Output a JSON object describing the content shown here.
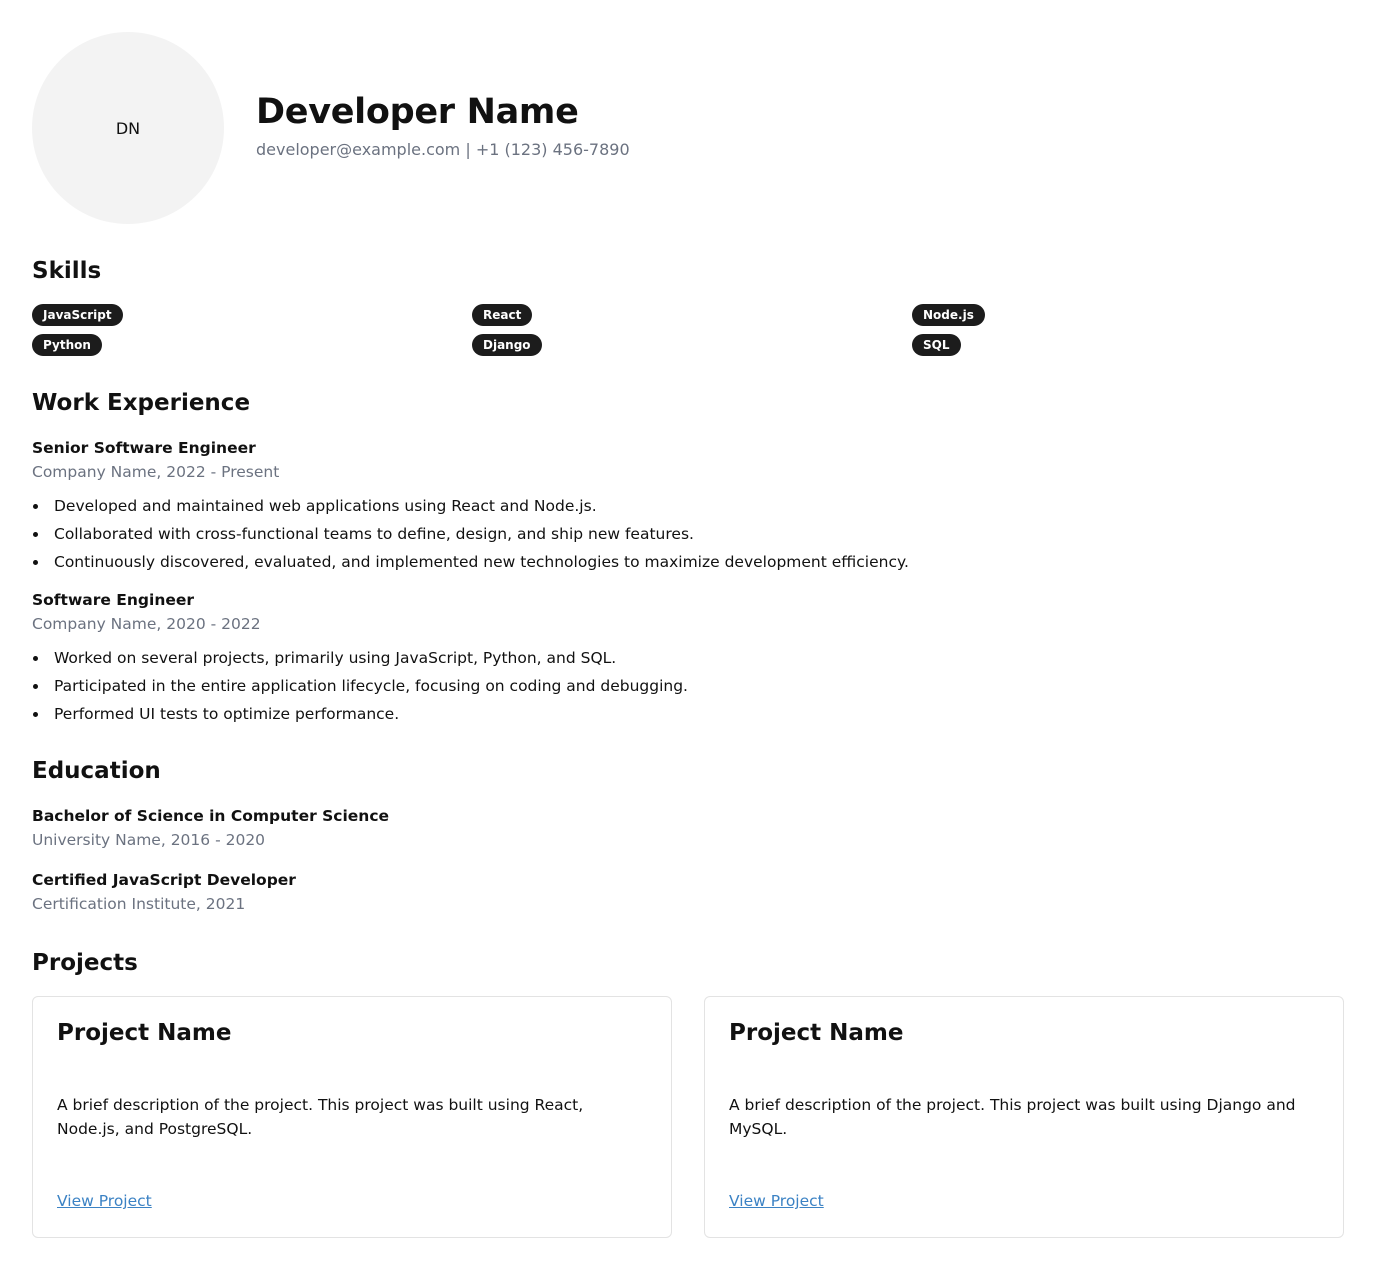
{
  "profile": {
    "initials": "DN",
    "name": "Developer Name",
    "contact": "developer@example.com | +1 (123) 456-7890"
  },
  "sections": {
    "skills": "Skills",
    "experience": "Work Experience",
    "education": "Education",
    "projects": "Projects"
  },
  "skills": [
    "JavaScript",
    "React",
    "Node.js",
    "Python",
    "Django",
    "SQL"
  ],
  "experience": [
    {
      "title": "Senior Software Engineer",
      "meta": "Company Name, 2022 - Present",
      "bullets": [
        "Developed and maintained web applications using React and Node.js.",
        "Collaborated with cross-functional teams to define, design, and ship new features.",
        "Continuously discovered, evaluated, and implemented new technologies to maximize development efficiency."
      ]
    },
    {
      "title": "Software Engineer",
      "meta": "Company Name, 2020 - 2022",
      "bullets": [
        "Worked on several projects, primarily using JavaScript, Python, and SQL.",
        "Participated in the entire application lifecycle, focusing on coding and debugging.",
        "Performed UI tests to optimize performance."
      ]
    }
  ],
  "education": [
    {
      "title": "Bachelor of Science in Computer Science",
      "meta": "University Name, 2016 - 2020"
    },
    {
      "title": "Certified JavaScript Developer",
      "meta": "Certification Institute, 2021"
    }
  ],
  "projects": [
    {
      "title": "Project Name",
      "description": "A brief description of the project. This project was built using React, Node.js, and PostgreSQL.",
      "link": "View Project"
    },
    {
      "title": "Project Name",
      "description": "A brief description of the project. This project was built using Django and MySQL.",
      "link": "View Project"
    }
  ],
  "colors": {
    "badge_bg": "#1c1c1c",
    "muted_text": "#6b7280",
    "link": "#3b82c4",
    "avatar_bg": "#f3f3f3"
  }
}
